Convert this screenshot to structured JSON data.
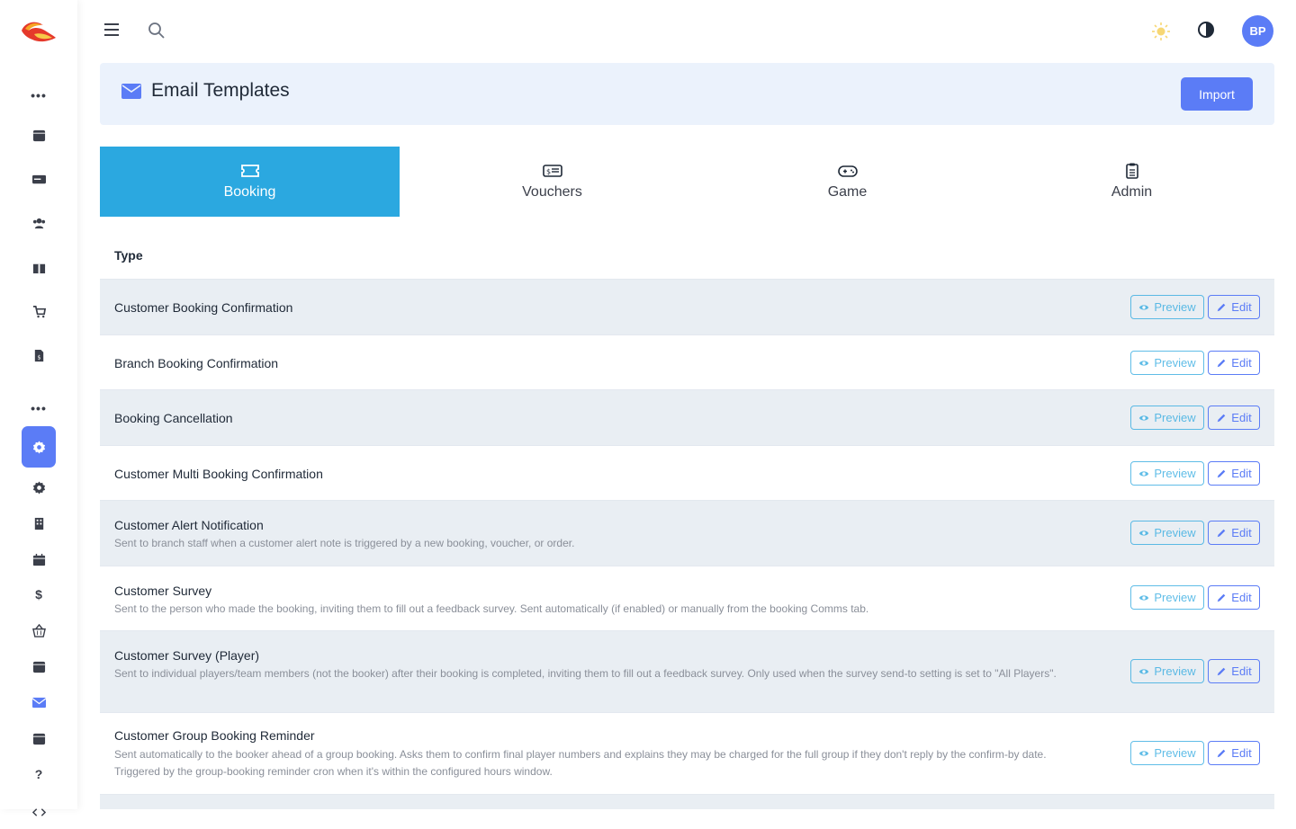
{
  "topbar": {
    "avatar_initials": "BP"
  },
  "header": {
    "title": "Email Templates",
    "import_label": "Import"
  },
  "tabs": [
    {
      "label": "Booking",
      "icon": "ticket-icon",
      "active": true
    },
    {
      "label": "Vouchers",
      "icon": "voucher-icon",
      "active": false
    },
    {
      "label": "Game",
      "icon": "gamepad-icon",
      "active": false
    },
    {
      "label": "Admin",
      "icon": "clipboard-icon",
      "active": false
    }
  ],
  "table": {
    "type_header": "Type",
    "preview_label": "Preview",
    "edit_label": "Edit",
    "rows": [
      {
        "name": "Customer Booking Confirmation",
        "desc": ""
      },
      {
        "name": "Branch Booking Confirmation",
        "desc": ""
      },
      {
        "name": "Booking Cancellation",
        "desc": ""
      },
      {
        "name": "Customer Multi Booking Confirmation",
        "desc": ""
      },
      {
        "name": "Customer Alert Notification",
        "desc": "Sent to branch staff when a customer alert note is triggered by a new booking, voucher, or order."
      },
      {
        "name": "Customer Survey",
        "desc": "Sent to the person who made the booking, inviting them to fill out a feedback survey. Sent automatically (if enabled) or manually from the booking Comms tab."
      },
      {
        "name": "Customer Survey (Player)",
        "desc": "Sent to individual players/team members (not the booker) after their booking is completed, inviting them to fill out a feedback survey. Only used when the survey send-to setting is set to \"All Players\"."
      },
      {
        "name": "Customer Group Booking Reminder",
        "desc": "Sent automatically to the booker ahead of a group booking. Asks them to confirm final player numbers and explains they may be charged for the full group if they don't reply by the confirm-by date. Triggered by the group-booking reminder cron when it's within the configured hours window."
      }
    ]
  },
  "sidebar": {
    "icons": [
      "more-icon",
      "calendar-icon",
      "card-icon",
      "users-icon",
      "gift-icon",
      "cart-icon",
      "invoice-icon",
      "more-icon",
      "settings-icon",
      "gear-icon",
      "building-icon",
      "calendar-grid-icon",
      "dollar-icon",
      "basket-icon",
      "calendar-icon",
      "mail-icon",
      "calendar-icon",
      "help-icon",
      "code-icon"
    ],
    "dollar_glyph": "$",
    "help_glyph": "?"
  },
  "colors": {
    "accent": "#5b7cf6",
    "tab_active": "#2ba8e0",
    "header_bg": "#ebf2fc",
    "row_shaded": "#e9eef3"
  }
}
